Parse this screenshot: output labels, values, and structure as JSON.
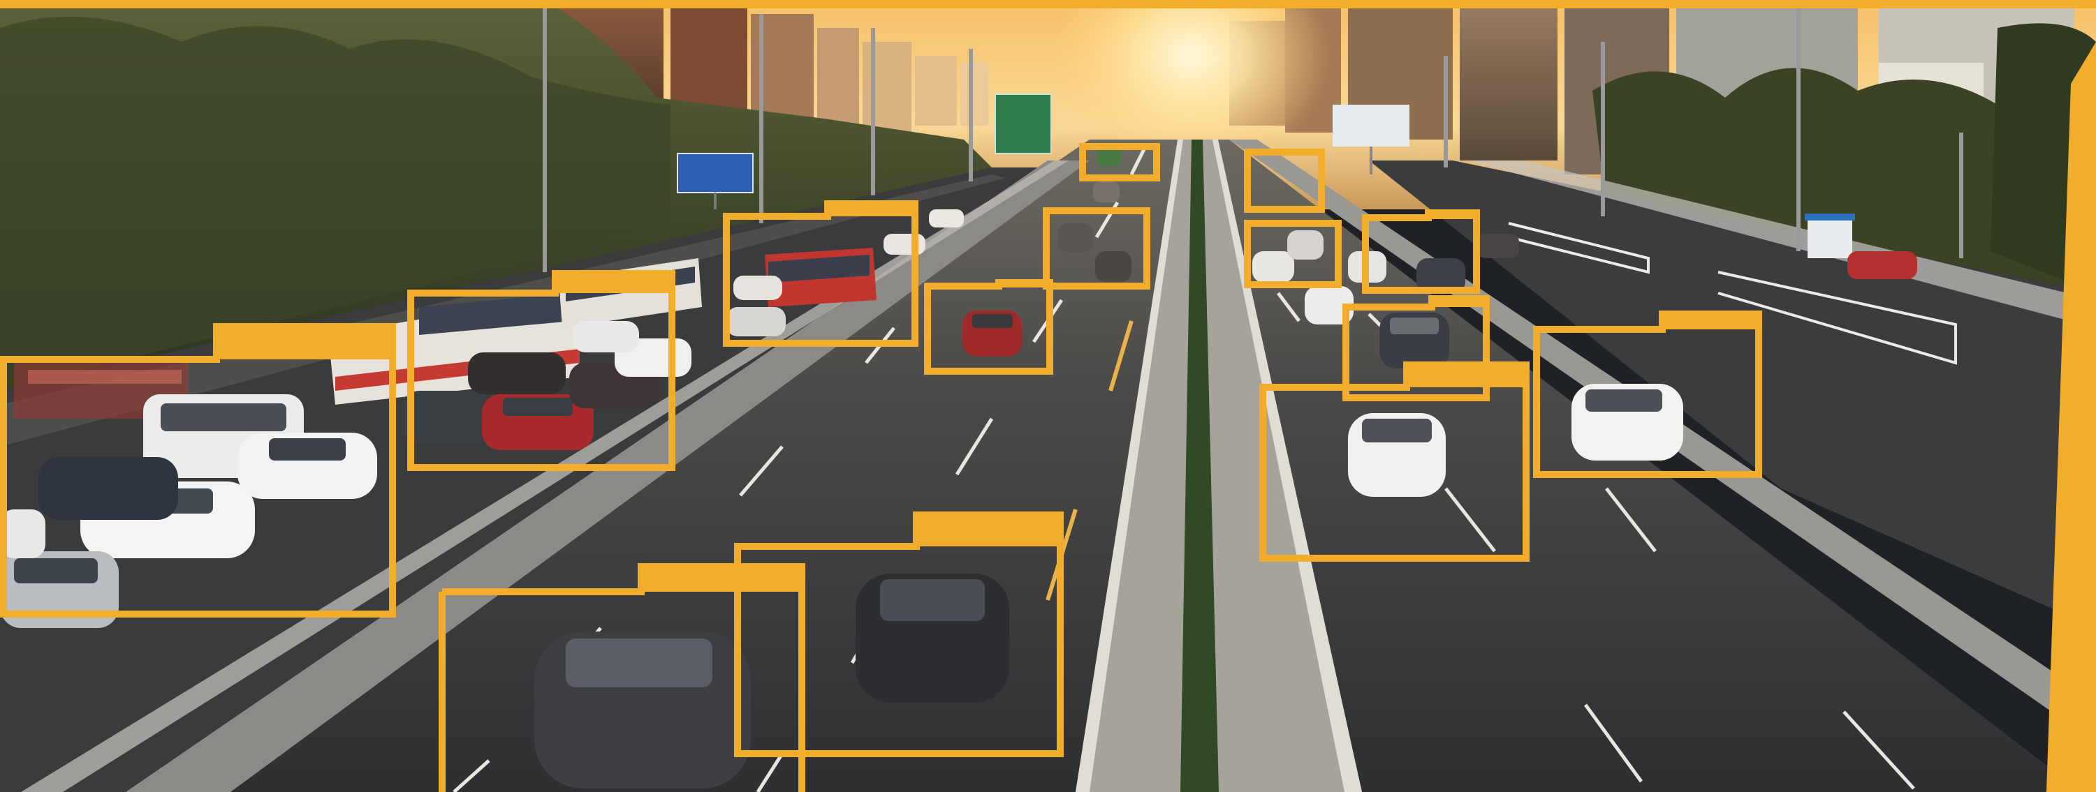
{
  "scene": {
    "description_label": "",
    "detection_box_color": "#f2ad2c",
    "frame_color": "#f2ad2c",
    "signs": [
      {
        "id": "blue-road-sign",
        "lines": [
          "",
          ""
        ]
      },
      {
        "id": "green-road-sign",
        "lines": [
          "",
          ""
        ]
      }
    ],
    "detections": [
      {
        "id": "det-1",
        "object": "car"
      },
      {
        "id": "det-2",
        "object": "car"
      },
      {
        "id": "det-3",
        "object": "car"
      },
      {
        "id": "det-4",
        "object": "car"
      },
      {
        "id": "det-5",
        "object": "car"
      },
      {
        "id": "det-6",
        "object": "car"
      },
      {
        "id": "det-7",
        "object": "car"
      },
      {
        "id": "det-8",
        "object": "car"
      },
      {
        "id": "det-9",
        "object": "car"
      },
      {
        "id": "det-10",
        "object": "car"
      },
      {
        "id": "det-11",
        "object": "car"
      },
      {
        "id": "det-12",
        "object": "car"
      },
      {
        "id": "det-13",
        "object": "car"
      },
      {
        "id": "det-14",
        "object": "car"
      }
    ]
  }
}
